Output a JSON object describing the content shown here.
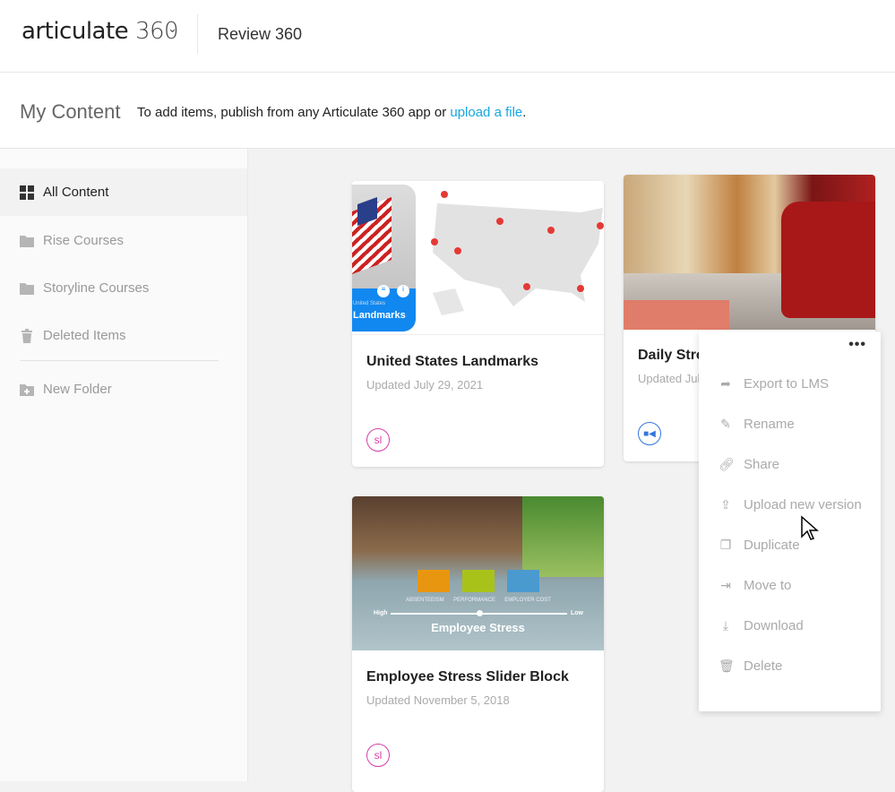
{
  "header": {
    "logo_text": "articulate",
    "logo_num": "360",
    "app_name": "Review 360"
  },
  "subheader": {
    "title": "My Content",
    "hint": "To add items, publish from any Articulate 360 app or ",
    "link": "upload a file",
    "period": "."
  },
  "sidebar": {
    "items": [
      {
        "label": "All Content"
      },
      {
        "label": "Rise Courses"
      },
      {
        "label": "Storyline Courses"
      },
      {
        "label": "Deleted Items"
      },
      {
        "label": "New Folder"
      }
    ]
  },
  "cards": [
    {
      "title": "United States Landmarks",
      "date": "Updated July 29, 2021",
      "badge": "sl",
      "thumb_sub": "United States",
      "thumb_title": "Landmarks"
    },
    {
      "title": "Daily Stre",
      "date": "Updated Jul"
    },
    {
      "title": "Employee Stress Slider Block",
      "date": "Updated November 5, 2018",
      "badge": "sl",
      "thumb": {
        "labels": [
          "ABSENTEEISM",
          "PERFORMANCE",
          "EMPLOYER COST"
        ],
        "high": "High",
        "low": "Low",
        "heading": "Employee Stress",
        "slider_value": 0.5
      }
    }
  ],
  "menu": {
    "dots": "•••",
    "items": [
      {
        "label": "Export to LMS",
        "icon": "share-arrow-icon"
      },
      {
        "label": "Rename",
        "icon": "pencil-icon"
      },
      {
        "label": "Share",
        "icon": "link-icon"
      },
      {
        "label": "Upload new version",
        "icon": "upload-icon"
      },
      {
        "label": "Duplicate",
        "icon": "duplicate-icon"
      },
      {
        "label": "Move to",
        "icon": "move-icon"
      },
      {
        "label": "Download",
        "icon": "download-icon"
      },
      {
        "label": "Delete",
        "icon": "trash-icon"
      }
    ]
  },
  "colors": {
    "link": "#16a6e0",
    "storyline": "#d63ea8",
    "video": "#3575e0"
  }
}
